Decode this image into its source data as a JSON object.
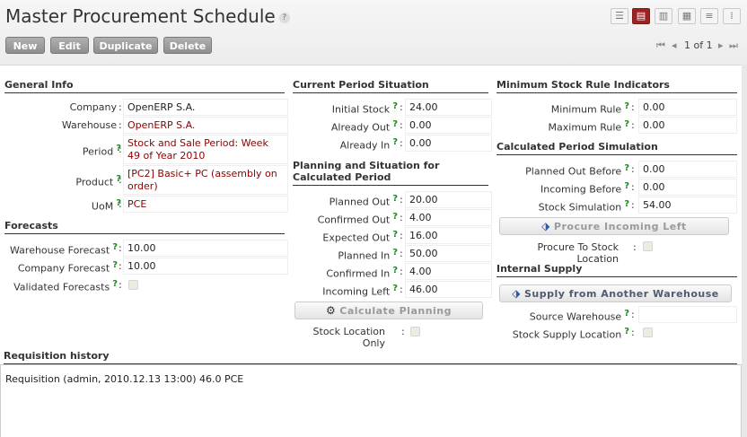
{
  "header": {
    "title": "Master Procurement Schedule",
    "help": "?"
  },
  "toolbar": {
    "new": "New",
    "edit": "Edit",
    "duplicate": "Duplicate",
    "delete": "Delete"
  },
  "pager": {
    "first": "⏮",
    "prev": "◂",
    "text": "1 of 1",
    "next": "▸",
    "last": "⏭"
  },
  "view_icons": [
    "list-view-icon",
    "form-view-icon",
    "graph-view-icon",
    "calendar-view-icon",
    "gantt-view-icon",
    "diagram-view-icon"
  ],
  "general": {
    "heading": "General Info",
    "company_label": "Company",
    "company": "OpenERP S.A.",
    "warehouse_label": "Warehouse",
    "warehouse": "OpenERP S.A.",
    "period_label": "Period",
    "period": "Stock and Sale Period: Week 49 of Year 2010",
    "product_label": "Product",
    "product": "[PC2] Basic+ PC (assembly on order)",
    "uom_label": "UoM",
    "uom": "PCE"
  },
  "forecasts": {
    "heading": "Forecasts",
    "warehouse_forecast_label": "Warehouse Forecast",
    "warehouse_forecast": "10.00",
    "company_forecast_label": "Company Forecast",
    "company_forecast": "10.00",
    "validated_label": "Validated Forecasts"
  },
  "current": {
    "heading": "Current Period Situation",
    "initial_stock_label": "Initial Stock",
    "initial_stock": "24.00",
    "already_out_label": "Already Out",
    "already_out": "0.00",
    "already_in_label": "Already In",
    "already_in": "0.00"
  },
  "planning": {
    "heading": "Planning and Situation for Calculated Period",
    "planned_out_label": "Planned Out",
    "planned_out": "20.00",
    "confirmed_out_label": "Confirmed Out",
    "confirmed_out": "4.00",
    "expected_out_label": "Expected Out",
    "expected_out": "16.00",
    "planned_in_label": "Planned In",
    "planned_in": "50.00",
    "confirmed_in_label": "Confirmed In",
    "confirmed_in": "4.00",
    "incoming_left_label": "Incoming Left",
    "incoming_left": "46.00",
    "calculate_button": "Calculate Planning",
    "stock_location_only_label": "Stock Location Only"
  },
  "min_rule": {
    "heading": "Minimum Stock Rule Indicators",
    "minimum_rule_label": "Minimum Rule",
    "minimum_rule": "0.00",
    "maximum_rule_label": "Maximum Rule",
    "maximum_rule": "0.00"
  },
  "simulation": {
    "heading": "Calculated Period Simulation",
    "planned_out_before_label": "Planned Out Before",
    "planned_out_before": "0.00",
    "incoming_before_label": "Incoming Before",
    "incoming_before": "0.00",
    "stock_simulation_label": "Stock Simulation",
    "stock_simulation": "54.00",
    "procure_button": "Procure Incoming Left",
    "procure_to_stock_label": "Procure To Stock Location"
  },
  "internal": {
    "heading": "Internal Supply",
    "supply_button": "Supply from Another Warehouse",
    "source_warehouse_label": "Source Warehouse",
    "source_warehouse": "",
    "stock_supply_location_label": "Stock Supply Location"
  },
  "history": {
    "heading": "Requisition history",
    "text": "Requisition (admin, 2010.12.13 13:00) 46.0 PCE"
  }
}
